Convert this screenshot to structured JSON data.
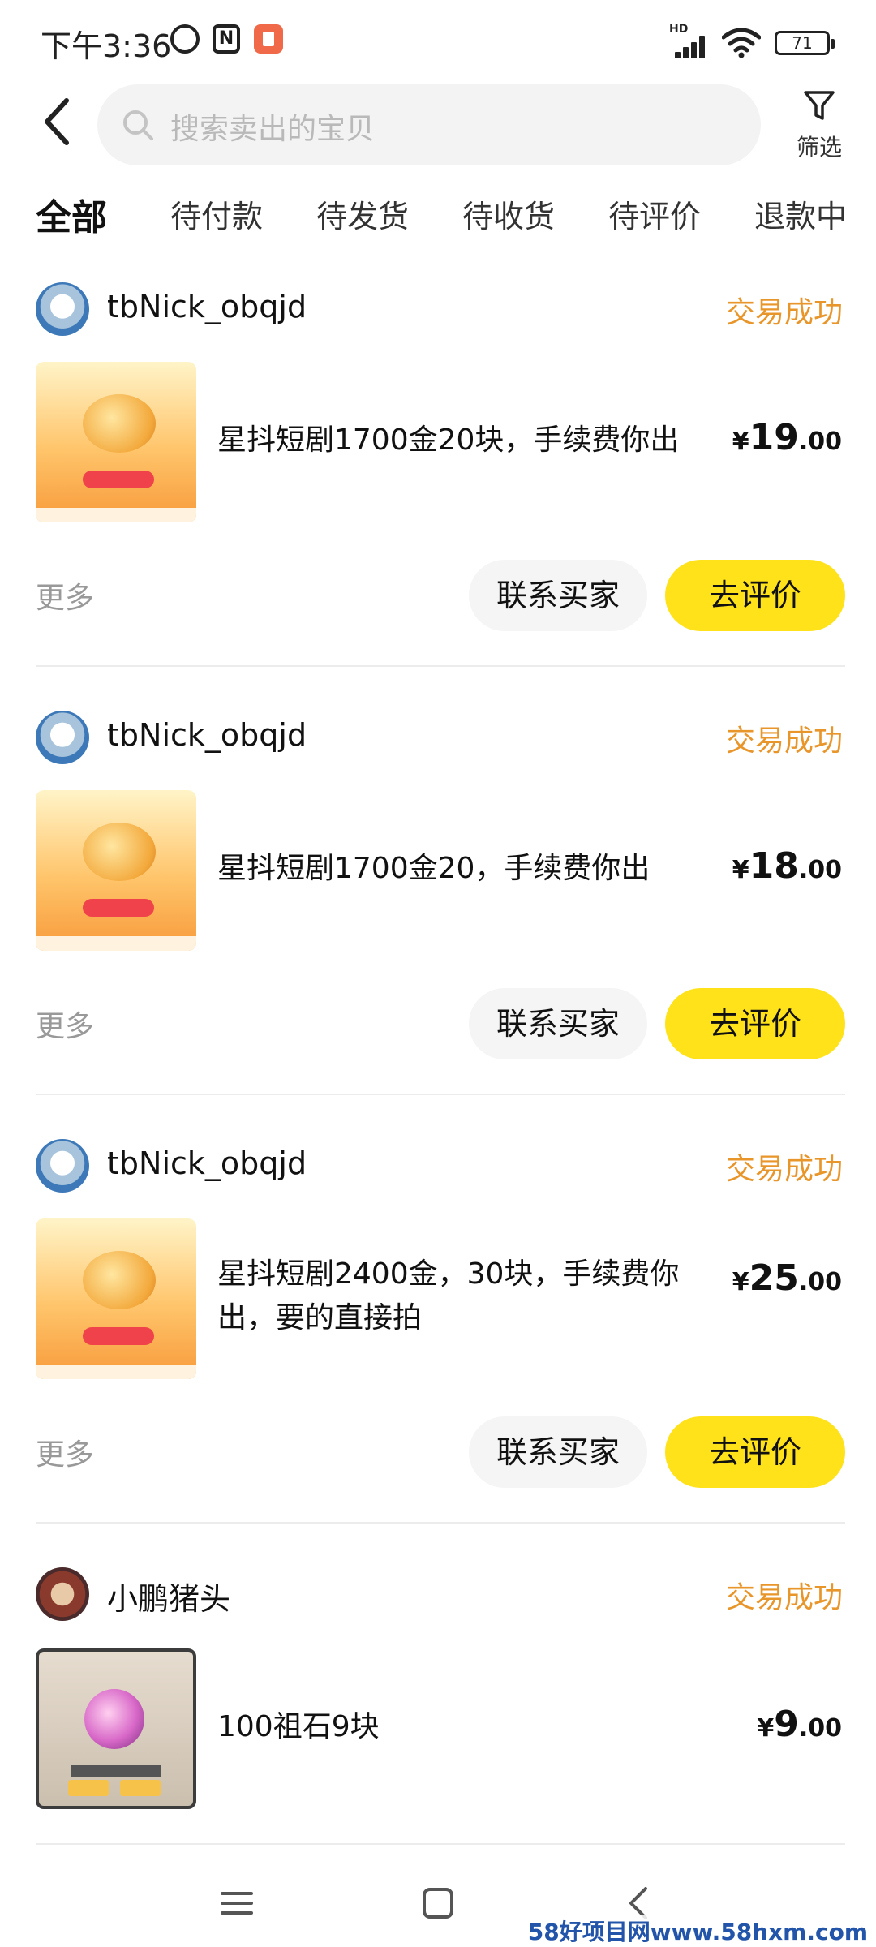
{
  "status_bar": {
    "time": "下午3:36",
    "hd": "HD",
    "battery": "71"
  },
  "header": {
    "search_placeholder": "搜索卖出的宝贝",
    "filter_label": "筛选"
  },
  "tabs": [
    {
      "label": "全部",
      "active": true
    },
    {
      "label": "待付款"
    },
    {
      "label": "待发货"
    },
    {
      "label": "待收货"
    },
    {
      "label": "待评价"
    },
    {
      "label": "退款中"
    }
  ],
  "orders": [
    {
      "seller": "tbNick_obqjd",
      "status": "交易成功",
      "title": "星抖短剧1700金20块，手续费你出",
      "currency": "¥",
      "price_int": "19",
      "price_dec": ".00",
      "more": "更多",
      "contact": "联系买家",
      "review": "去评价"
    },
    {
      "seller": "tbNick_obqjd",
      "status": "交易成功",
      "title": "星抖短剧1700金20，手续费你出",
      "currency": "¥",
      "price_int": "18",
      "price_dec": ".00",
      "more": "更多",
      "contact": "联系买家",
      "review": "去评价"
    },
    {
      "seller": "tbNick_obqjd",
      "status": "交易成功",
      "title": "星抖短剧2400金，30块，手续费你出，要的直接拍",
      "currency": "¥",
      "price_int": "25",
      "price_dec": ".00",
      "more": "更多",
      "contact": "联系买家",
      "review": "去评价"
    },
    {
      "seller": "小鹏猪头",
      "status": "交易成功",
      "title": "100祖石9块",
      "currency": "¥",
      "price_int": "9",
      "price_dec": ".00"
    }
  ],
  "watermark": "58好项目网www.58hxm.com",
  "colors": {
    "accent_yellow": "#ffe21a",
    "status_orange": "#e8952a"
  }
}
